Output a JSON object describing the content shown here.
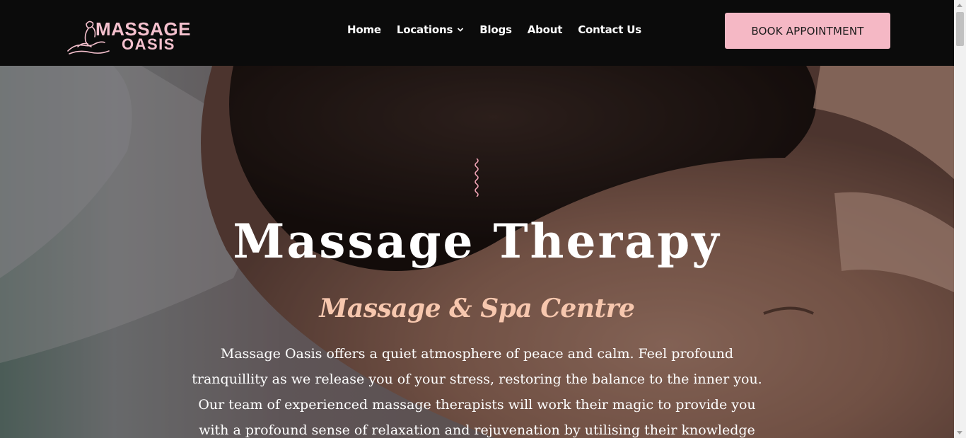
{
  "header": {
    "logo": {
      "line1": "MASSAGE",
      "line2": "OASIS",
      "icon": "massage-figure-logo",
      "color": "#f4c0cd"
    },
    "nav": [
      {
        "label": "Home"
      },
      {
        "label": "Locations",
        "icon": "chevron-down-icon"
      },
      {
        "label": "Blogs"
      },
      {
        "label": "About"
      },
      {
        "label": "Contact Us"
      }
    ],
    "cta_label": "BOOK APPOINTMENT",
    "background": "#0b0b0b",
    "cta_color": "#f5b8c5"
  },
  "hero": {
    "decoration_icon": "squiggle-line-icon",
    "title": "Massage Therapy",
    "subtitle": "Massage & Spa Centre",
    "subtitle_color": "#f7c7ae",
    "paragraph_lines": [
      "Massage Oasis offers a quiet atmosphere of peace and calm. Feel profound",
      "tranquillity as we release you of your stress, restoring the balance to the inner you.",
      "Our team of experienced massage therapists will work their magic to provide you",
      "with a profound sense of relaxation and rejuvenation by utilising their knowledge"
    ]
  }
}
